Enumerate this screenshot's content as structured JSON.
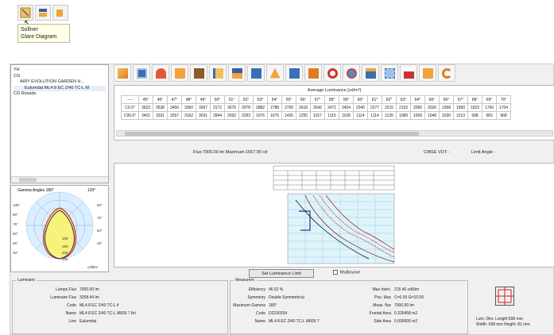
{
  "tooltip": {
    "line1": "Sollner",
    "line2": "Glare Diagram"
  },
  "tree": {
    "root": "YH",
    "cg": "CG",
    "item1": "AIRY EVOLUTION GARDEN H...",
    "item2": "Eulumdat ML4 8 EC 2/40 TC-L M",
    "item3": "CG Rosads"
  },
  "polar": {
    "title_left": "Gamma Angles  180°",
    "title_right": "120°",
    "ticks_left": [
      "105°",
      "90°",
      "75°",
      "60°",
      "45°",
      "30°"
    ],
    "ticks_right": [
      "90°",
      "75°",
      "60°",
      "45°"
    ],
    "radial_labels": [
      "100",
      "150",
      "200",
      "250"
    ],
    "unit": "cd/klm"
  },
  "table": {
    "title": "Average Luminance [cd/m²]",
    "header": [
      "----",
      "45°",
      "46°",
      "47°",
      "48°",
      "49°",
      "50°",
      "51°",
      "52°",
      "53°",
      "54°",
      "55°",
      "56°",
      "57°",
      "58°",
      "59°",
      "60°",
      "61°",
      "62°",
      "63°",
      "64°",
      "65°",
      "66°",
      "67°",
      "68°",
      "69°",
      "70°"
    ],
    "rows": [
      [
        "C0.0°",
        "3623",
        "3538",
        "3450",
        "3360",
        "3267",
        "3172",
        "3075",
        "2978",
        "2882",
        "2788",
        "2700",
        "2618",
        "2542",
        "2471",
        "2404",
        "2340",
        "2277",
        "2215",
        "2153",
        "2090",
        "2026",
        "1958",
        "1890",
        "1823",
        "1760",
        "1704"
      ],
      [
        "C90.0°",
        "3401",
        "3331",
        "3257",
        "3162",
        "3031",
        "2844",
        "2592",
        "2293",
        "1976",
        "1675",
        "1425",
        "1255",
        "1157",
        "1115",
        "1108",
        "1114",
        "1114",
        "1135",
        "1089",
        "1069",
        "1048",
        "1030",
        "1013",
        "998",
        "983",
        "968"
      ]
    ]
  },
  "flux": {
    "flux": "Flux:7000.00 lm  Maximum:1567.90 cd",
    "cibse": "CIBSE VDT: -",
    "limit": "Limit Angle -"
  },
  "bottom": {
    "set_button": "Set Luminance Limit",
    "multicurve": "Multicurve"
  },
  "luminaire": {
    "legend": "Luminaire",
    "rows": [
      {
        "k": "Lamps Flux",
        "v": "7000.00 lm"
      },
      {
        "k": "Luminaire Flux",
        "v": "3258.44 lm"
      },
      {
        "k": "Code",
        "v": "ML4 8 EC 2/40 TC-L if"
      },
      {
        "k": "Name",
        "v": "ML4 8 EC 2/40 TC-L M600 7 Ari"
      },
      {
        "k": "Line",
        "v": "Eulumdat"
      }
    ]
  },
  "measurem": {
    "legend": "Measurem.",
    "rows": [
      {
        "k": "Efficiency",
        "v": "46.52 %"
      },
      {
        "k": "Symmetry",
        "v": "Double Symmetrical"
      },
      {
        "k": "Maximum Gamma",
        "v": "180°"
      },
      {
        "k": "Code",
        "v": "D2230334"
      },
      {
        "k": "Name",
        "v": "ML4 8 EC 2/40 TC-L M600 7"
      }
    ],
    "rows_right": [
      {
        "k": "Max Inten.",
        "v": "215.40 cd/klm"
      },
      {
        "k": "Pos. Max",
        "v": "C=0.00 G=10.00"
      },
      {
        "k": "Meas. flux",
        "v": "7000.00 lm"
      },
      {
        "k": "Frontal Area",
        "v": "0.325458 m2"
      },
      {
        "k": "Side Area",
        "v": "0.000000 m2"
      }
    ]
  },
  "dims": {
    "line1": "Lum. Dim.  Length:598 mm",
    "line2": "Width: 598 mm Height: 81 mm"
  }
}
